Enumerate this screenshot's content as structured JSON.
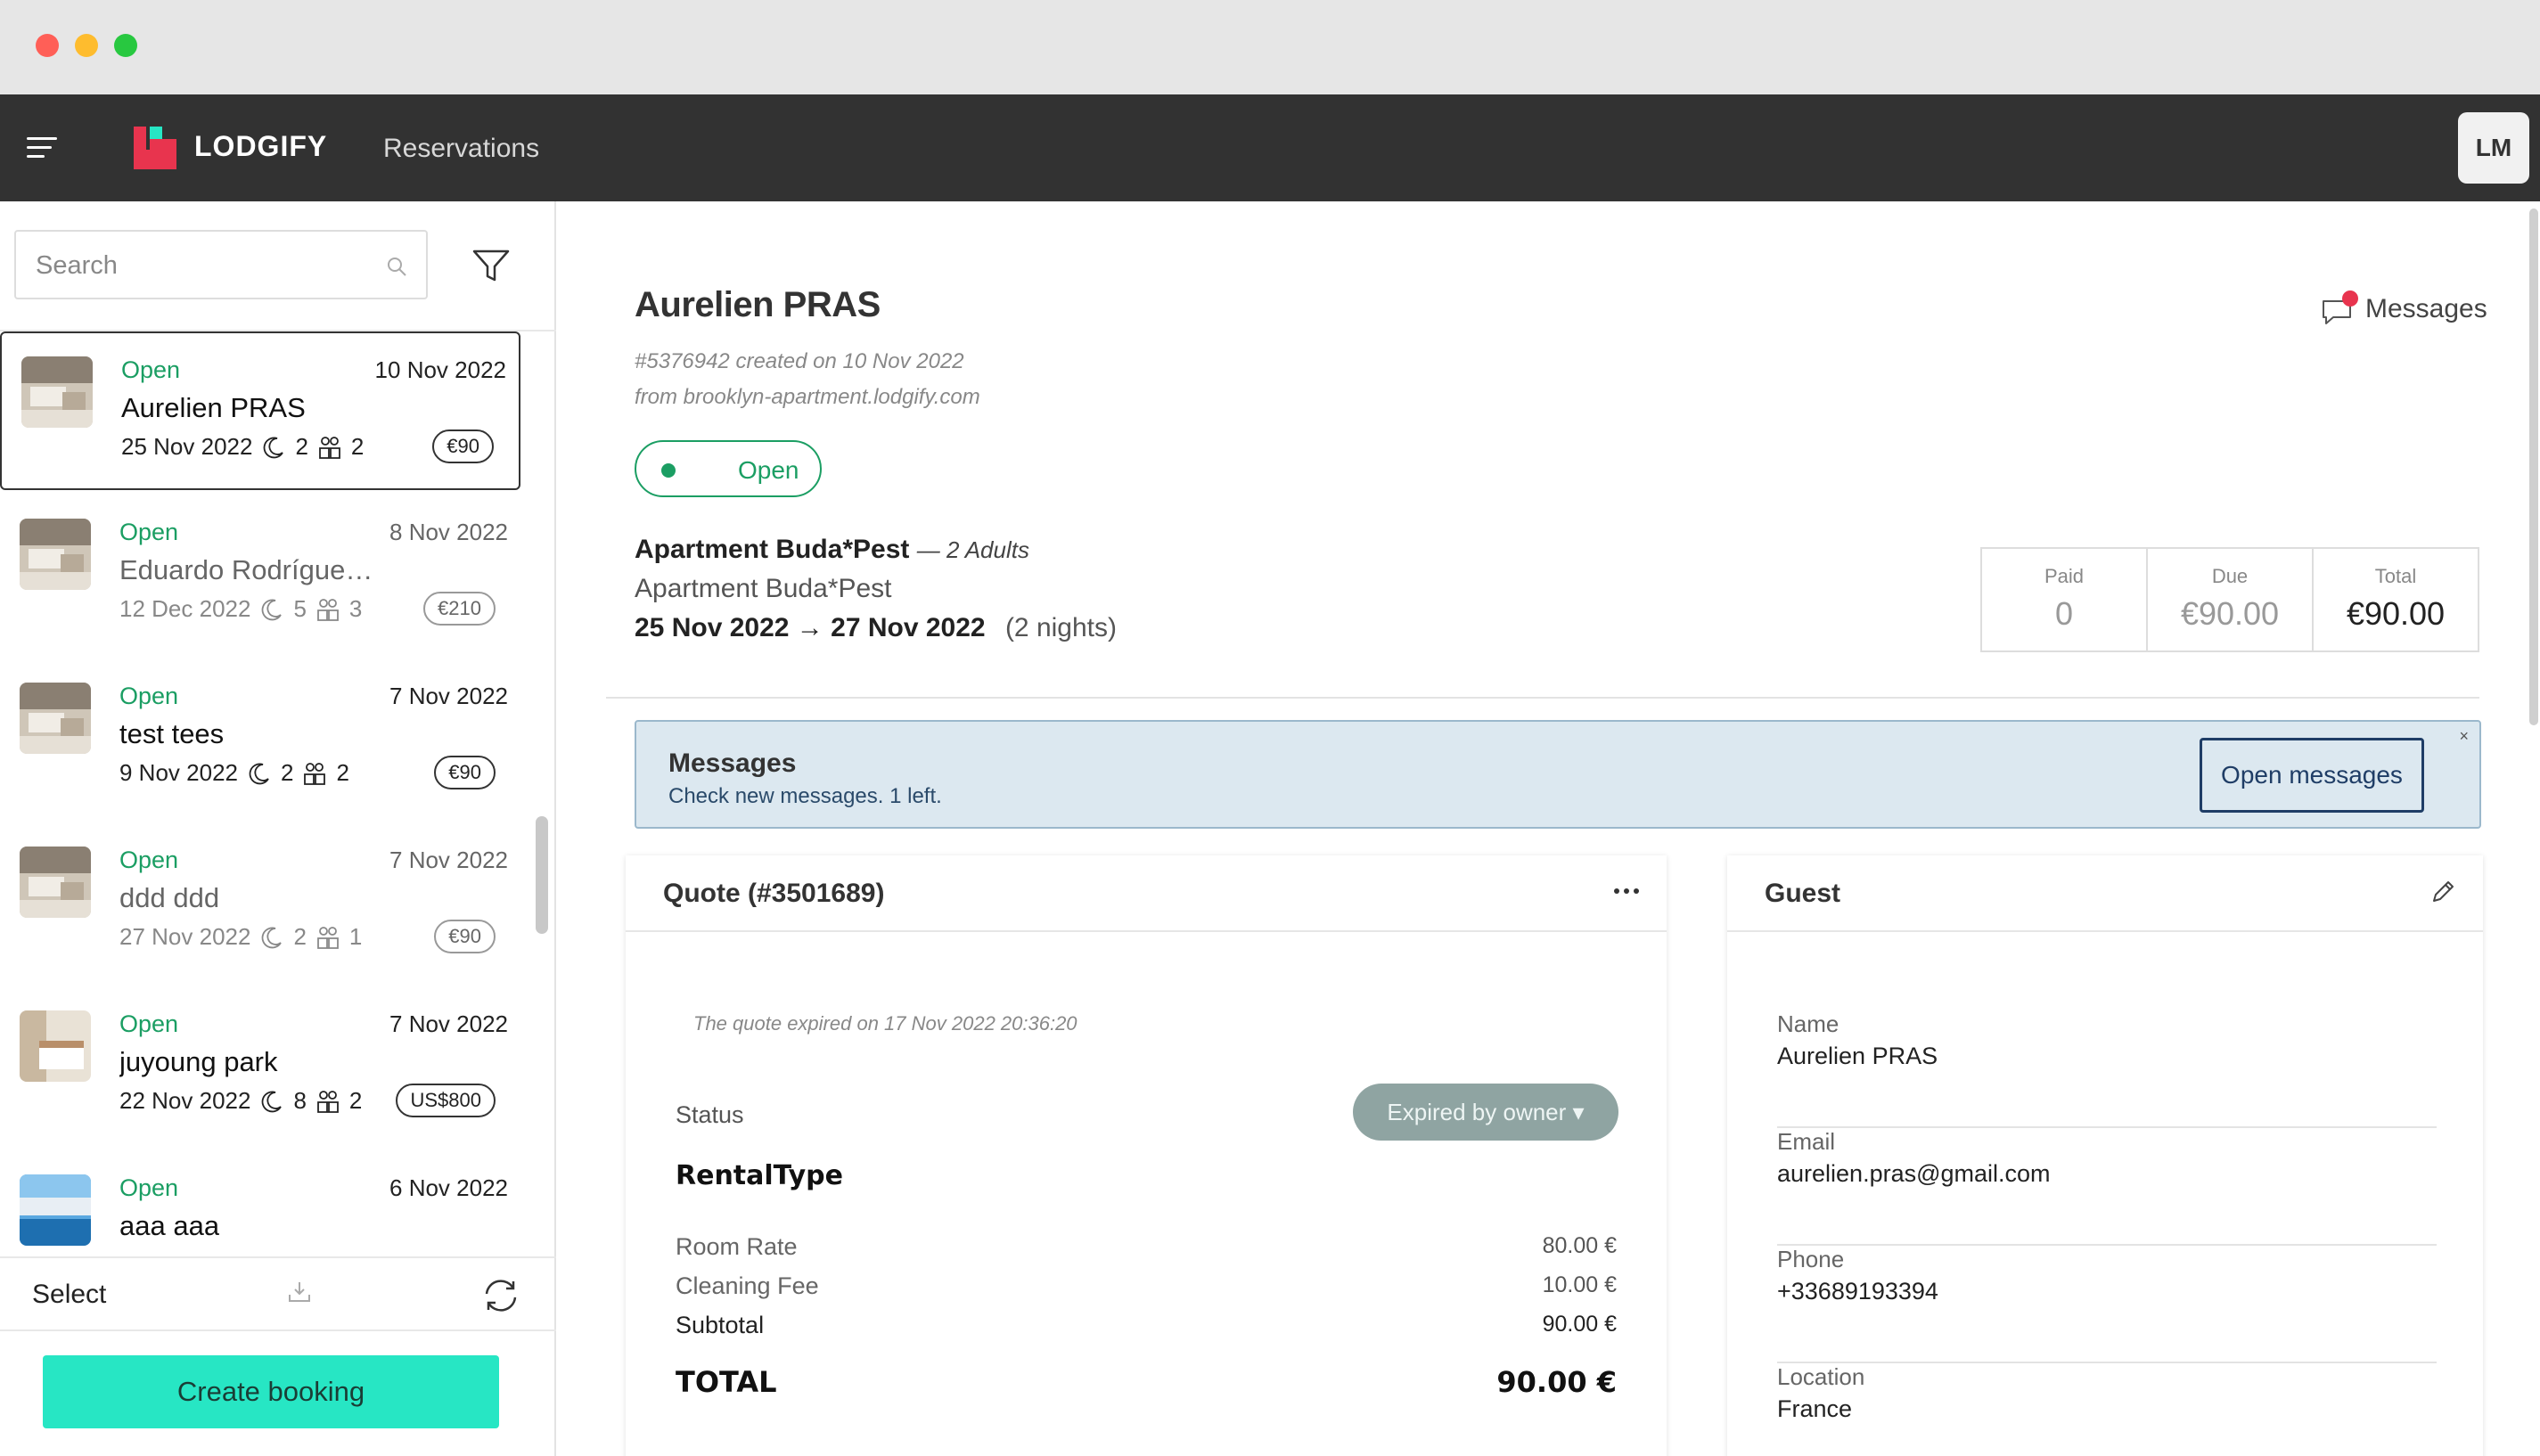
{
  "nav": {
    "logo_text": "LODGIFY",
    "title": "Reservations",
    "avatar_initials": "LM"
  },
  "sidebar": {
    "search_placeholder": "Search",
    "items": [
      {
        "status": "Open",
        "date": "10 Nov 2022",
        "name": "Aurelien PRAS",
        "checkin": "25 Nov 2022",
        "nights": "2",
        "guests": "2",
        "price": "€90",
        "muted": false,
        "selected": true,
        "thumb": "room"
      },
      {
        "status": "Open",
        "date": "8 Nov 2022",
        "name": "Eduardo Rodrígue…",
        "checkin": "12 Dec 2022",
        "nights": "5",
        "guests": "3",
        "price": "€210",
        "muted": true,
        "selected": false,
        "thumb": "room"
      },
      {
        "status": "Open",
        "date": "7 Nov 2022",
        "name": "test tees",
        "checkin": "9 Nov 2022",
        "nights": "2",
        "guests": "2",
        "price": "€90",
        "muted": false,
        "selected": false,
        "thumb": "room"
      },
      {
        "status": "Open",
        "date": "7 Nov 2022",
        "name": "ddd ddd",
        "checkin": "27 Nov 2022",
        "nights": "2",
        "guests": "1",
        "price": "€90",
        "muted": true,
        "selected": false,
        "thumb": "room"
      },
      {
        "status": "Open",
        "date": "7 Nov 2022",
        "name": "juyoung park",
        "checkin": "22 Nov 2022",
        "nights": "8",
        "guests": "2",
        "price": "US$800",
        "muted": false,
        "selected": false,
        "thumb": "bedroom"
      },
      {
        "status": "Open",
        "date": "6 Nov 2022",
        "name": "aaa aaa",
        "checkin": "",
        "nights": "",
        "guests": "",
        "price": "",
        "muted": false,
        "selected": false,
        "thumb": "pool"
      }
    ],
    "select_label": "Select",
    "create_button": "Create booking"
  },
  "reservation": {
    "guest_name": "Aurelien PRAS",
    "created_line": "#5376942 created on 10 Nov 2022",
    "source_line": "from brooklyn-apartment.lodgify.com",
    "status": "Open",
    "messages_link": "Messages",
    "property_name": "Apartment Buda*Pest",
    "guests_summary": "— 2 Adults",
    "property_sub": "Apartment Buda*Pest",
    "date_from": "25 Nov 2022",
    "arrow": "→",
    "date_to": "27 Nov 2022",
    "nights": "(2 nights)",
    "totals": [
      {
        "label": "Paid",
        "value": "0"
      },
      {
        "label": "Due",
        "value": "€90.00"
      },
      {
        "label": "Total",
        "value": "€90.00"
      }
    ]
  },
  "messages_banner": {
    "title": "Messages",
    "subtitle": "Check new messages. 1 left.",
    "button": "Open messages",
    "close": "×"
  },
  "quote": {
    "title": "Quote (#3501689)",
    "expired_note": "The quote expired on 17 Nov 2022 20:36:20",
    "status_label": "Status",
    "status_value": "Expired by owner ▾",
    "rental_type": "RentalType",
    "rows": [
      {
        "label": "Room Rate",
        "value": "80.00 €"
      },
      {
        "label": "Cleaning Fee",
        "value": "10.00 €"
      },
      {
        "label": "Subtotal",
        "value": "90.00 €"
      }
    ],
    "total_label": "TOTAL",
    "total_value": "90.00 €"
  },
  "guest": {
    "title": "Guest",
    "fields": [
      {
        "label": "Name",
        "value": "Aurelien PRAS"
      },
      {
        "label": "Email",
        "value": "aurelien.pras@gmail.com"
      },
      {
        "label": "Phone",
        "value": "+33689193394"
      },
      {
        "label": "Location",
        "value": "France"
      }
    ]
  },
  "colors": {
    "brand_red": "#e8344e",
    "brand_teal": "#27e6c4",
    "status_green": "#1b9e63",
    "nav_bg": "#323232"
  }
}
